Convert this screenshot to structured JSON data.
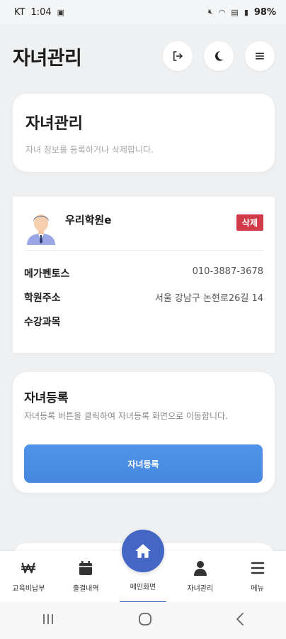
{
  "status_bar": {
    "carrier": "KT",
    "time": "1:04",
    "battery": "98%"
  },
  "header": {
    "title": "자녀관리",
    "buttons": [
      {
        "icon": "logout-icon"
      },
      {
        "icon": "moon-icon"
      },
      {
        "icon": "menu-icon"
      }
    ]
  },
  "intro": {
    "title": "자녀관리",
    "subtitle": "자녀 정보를 등록하거나 삭제합니다."
  },
  "child": {
    "name": "우리학원e",
    "delete_label": "삭제",
    "rows": [
      {
        "label": "메가펜토스",
        "value": "010-3887-3678"
      },
      {
        "label": "학원주소",
        "value": "서울 강남구 논현로26길 14"
      },
      {
        "label": "수강과목",
        "value": ""
      }
    ]
  },
  "register": {
    "title": "자녀등록",
    "description": "자녀등록 버튼을 클릭하여 자녀등록 화면으로 이동합니다.",
    "button_label": "자녀등록"
  },
  "bottom_nav": {
    "items": [
      {
        "label": "교육비납부",
        "icon": "won-icon"
      },
      {
        "label": "출결내역",
        "icon": "calendar-icon"
      },
      {
        "label": "메인화면",
        "icon": "home-icon"
      },
      {
        "label": "자녀관리",
        "icon": "person-icon"
      },
      {
        "label": "메뉴",
        "icon": "menu-icon"
      }
    ]
  },
  "colors": {
    "accent": "#4a8ee6",
    "home": "#4467c6",
    "danger": "#d13a48"
  }
}
